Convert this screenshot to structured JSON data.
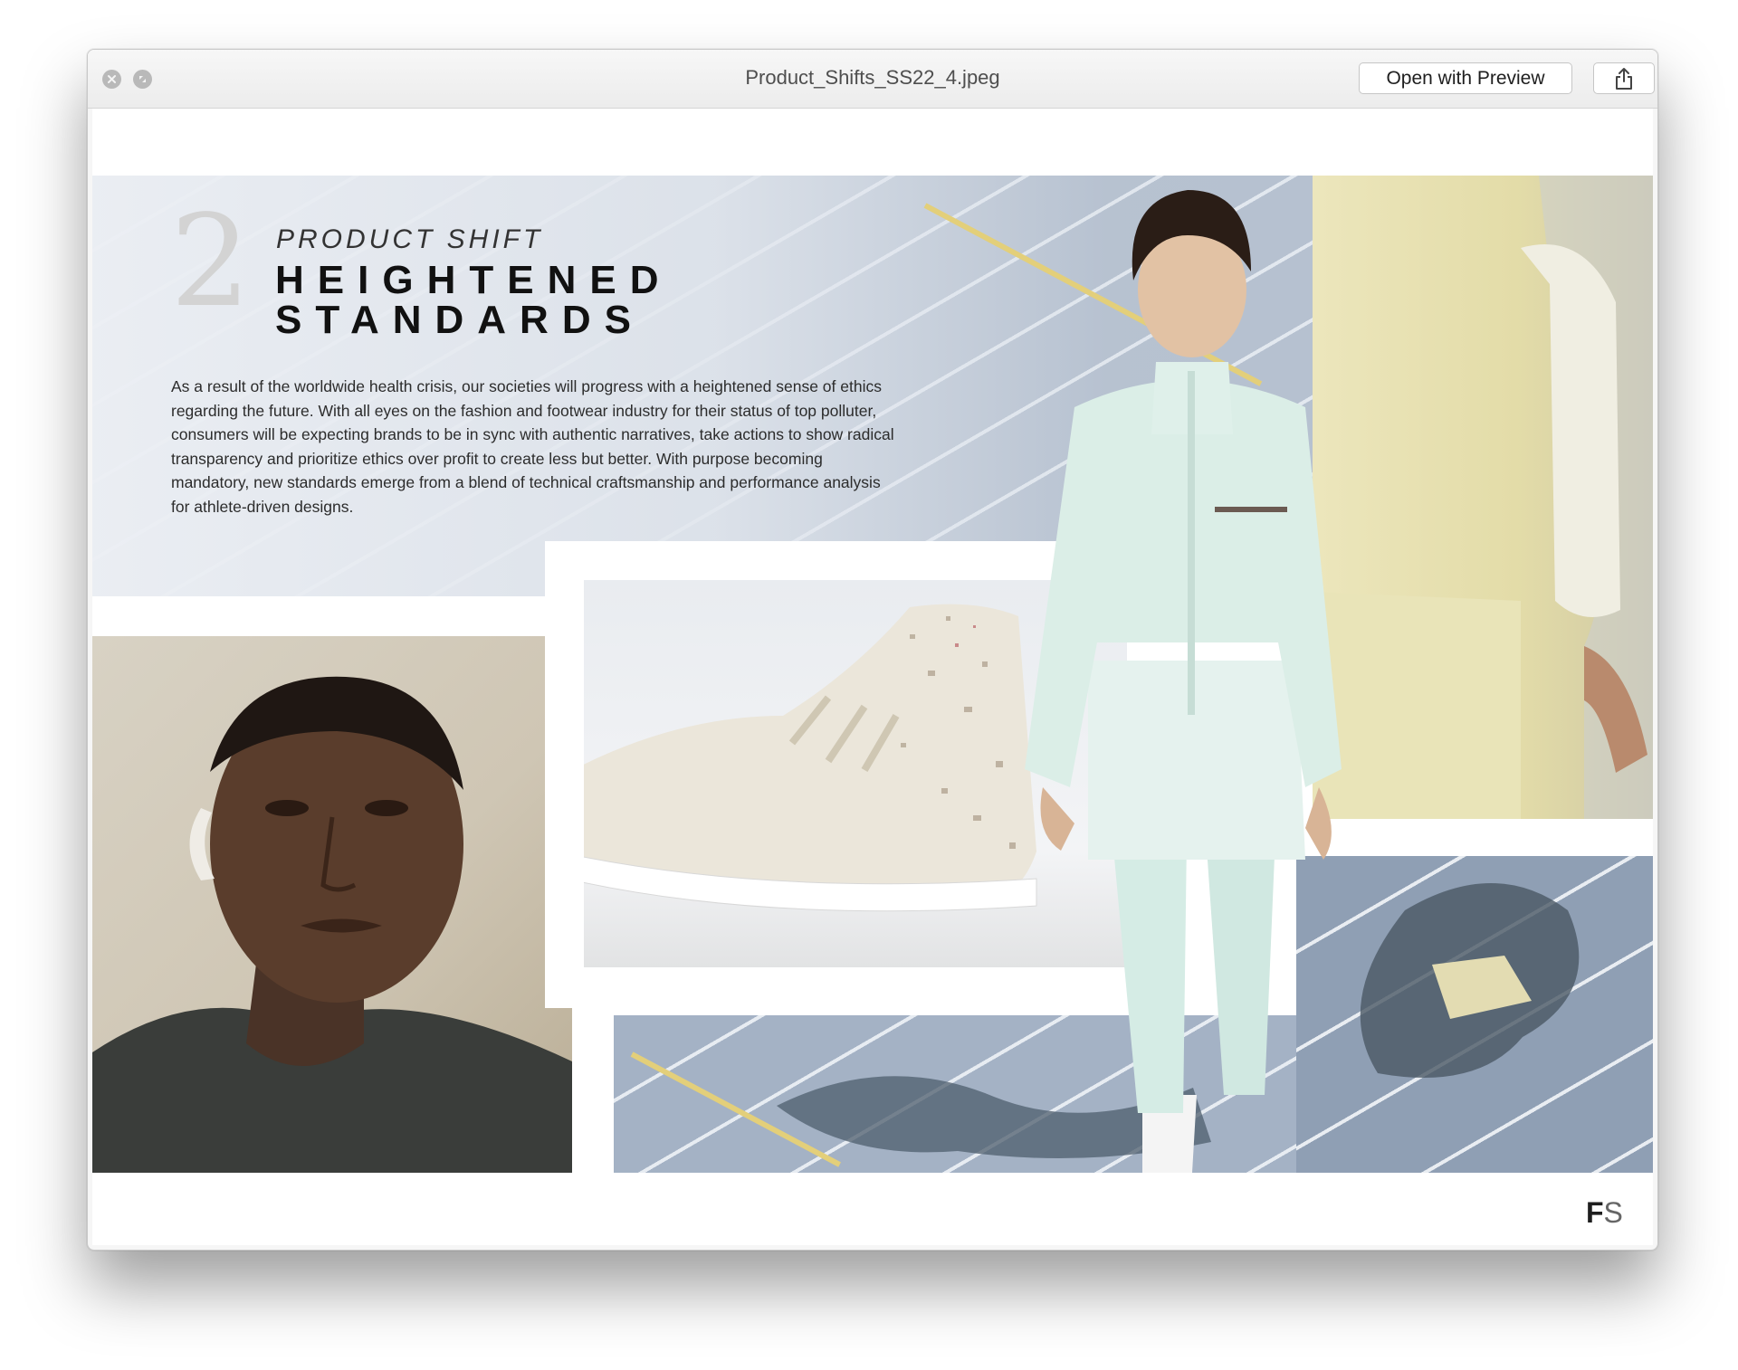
{
  "window": {
    "title": "Product_Shifts_SS22_4.jpeg",
    "open_with_label": "Open with Preview"
  },
  "icons": {
    "close": "close-icon",
    "fullscreen": "fullscreen-icon",
    "share": "share-icon"
  },
  "slide": {
    "number": "2",
    "kicker": "PRODUCT SHIFT",
    "headline_line1": "HEIGHTENED",
    "headline_line2": "STANDARDS",
    "body": "As a result of the worldwide health crisis, our societies will progress with a heightened sense of ethics regarding the future. With all eyes on the fashion and footwear industry for their status of top polluter, consumers will be expecting brands to be in sync with authentic narratives, take actions to show radical transparency and prioritize ethics over profit to create less but better. With purpose becoming mandatory, new standards emerge from a blend of technical craftsmanship and performance analysis for athlete-driven designs.",
    "logo_f": "F",
    "logo_s": "S"
  },
  "colors": {
    "track_blue": "#b5c0cf",
    "lane_yellow": "#e3cf7a",
    "mint_outfit": "#dceee6",
    "shirt_yellow": "#e6dfae"
  }
}
